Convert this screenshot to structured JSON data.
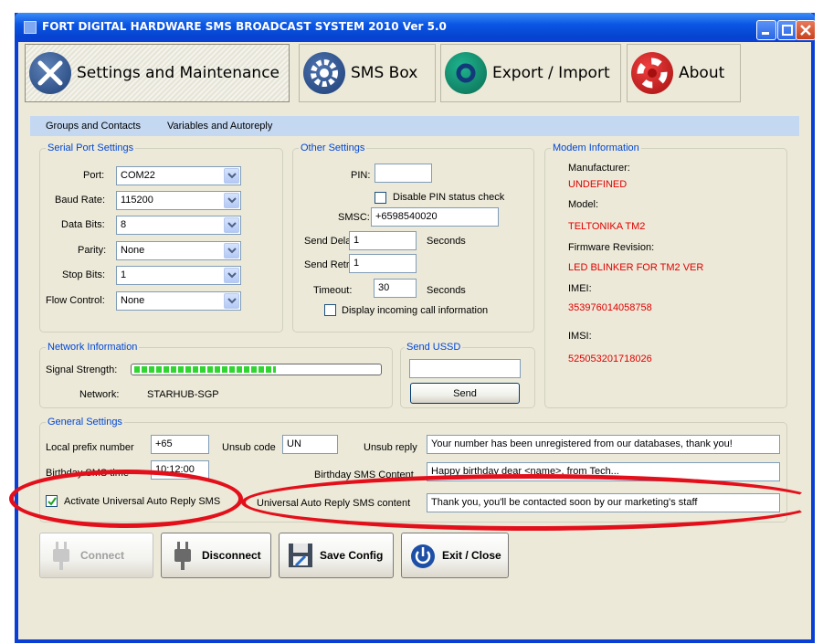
{
  "window": {
    "title": "FORT DIGITAL HARDWARE SMS BROADCAST SYSTEM 2010 Ver 5.0",
    "controls": [
      "minimize",
      "maximize",
      "close"
    ]
  },
  "nav": {
    "tabs": [
      {
        "label": "Settings and Maintenance",
        "icon": "wrench-screwdriver-icon",
        "active": true
      },
      {
        "label": "SMS Box",
        "icon": "gear-icon",
        "active": false
      },
      {
        "label": "Export / Import",
        "icon": "refresh-icon",
        "active": false
      },
      {
        "label": "About",
        "icon": "lifebuoy-icon",
        "active": false
      }
    ]
  },
  "subtabs": [
    "Groups and Contacts",
    "Variables and Autoreply"
  ],
  "serial_port": {
    "title": "Serial Port Settings",
    "fields": [
      {
        "label": "Port:",
        "value": "COM22"
      },
      {
        "label": "Baud Rate:",
        "value": "115200"
      },
      {
        "label": "Data Bits:",
        "value": "8"
      },
      {
        "label": "Parity:",
        "value": "None"
      },
      {
        "label": "Stop Bits:",
        "value": "1"
      },
      {
        "label": "Flow Control:",
        "value": "None"
      }
    ]
  },
  "other_settings": {
    "title": "Other Settings",
    "pin_label": "PIN:",
    "pin_value": "",
    "disable_pin_label": "Disable PIN status check",
    "disable_pin_checked": false,
    "smsc_label": "SMSC:",
    "smsc_value": "+6598540020",
    "send_delay_label": "Send Delay:",
    "send_delay_value": "1",
    "send_delay_unit": "Seconds",
    "send_retry_label": "Send Retry:",
    "send_retry_value": "1",
    "timeout_label": "Timeout:",
    "timeout_value": "30",
    "timeout_unit": "Seconds",
    "display_incoming_label": "Display incoming call information",
    "display_incoming_checked": false
  },
  "modem": {
    "title": "Modem Information",
    "manufacturer_label": "Manufacturer:",
    "manufacturer_value": "UNDEFINED",
    "model_label": "Model:",
    "model_value": "TELTONIKA TM2",
    "firmware_label": "Firmware Revision:",
    "firmware_value": "LED BLINKER FOR TM2 VER",
    "imei_label": "IMEI:",
    "imei_value": "353976014058758",
    "imsi_label": "IMSI:",
    "imsi_value": "525053201718026"
  },
  "network": {
    "title": "Network Information",
    "signal_label": "Signal Strength:",
    "signal_level": 0.58,
    "network_label": "Network:",
    "network_value": "STARHUB-SGP"
  },
  "ussd": {
    "title": "Send USSD",
    "input_value": "",
    "send_label": "Send"
  },
  "general": {
    "title": "General Settings",
    "local_prefix_label": "Local prefix number",
    "local_prefix_value": "+65",
    "unsub_code_label": "Unsub code",
    "unsub_code_value": "UN",
    "unsub_reply_label": "Unsub reply",
    "unsub_reply_value": "Your number has been unregistered from our databases, thank you!",
    "birthday_time_label": "Birthday SMS time",
    "birthday_time_value": "10:12:00",
    "birthday_content_label": "Birthday SMS Content",
    "birthday_content_value": "Happy birthday dear <name>, from Tech...",
    "auto_reply_label": "Activate Universal Auto Reply SMS",
    "auto_reply_checked": true,
    "auto_reply_content_label": "Universal Auto Reply SMS content",
    "auto_reply_content_value": "Thank you, you'll be contacted soon by our marketing's staff"
  },
  "actions": {
    "connect": "Connect",
    "disconnect": "Disconnect",
    "save": "Save Config",
    "exit": "Exit / Close"
  },
  "colors": {
    "accent_blue": "#0046d5",
    "value_red": "#e00000",
    "annotation_red": "#e3101b"
  }
}
